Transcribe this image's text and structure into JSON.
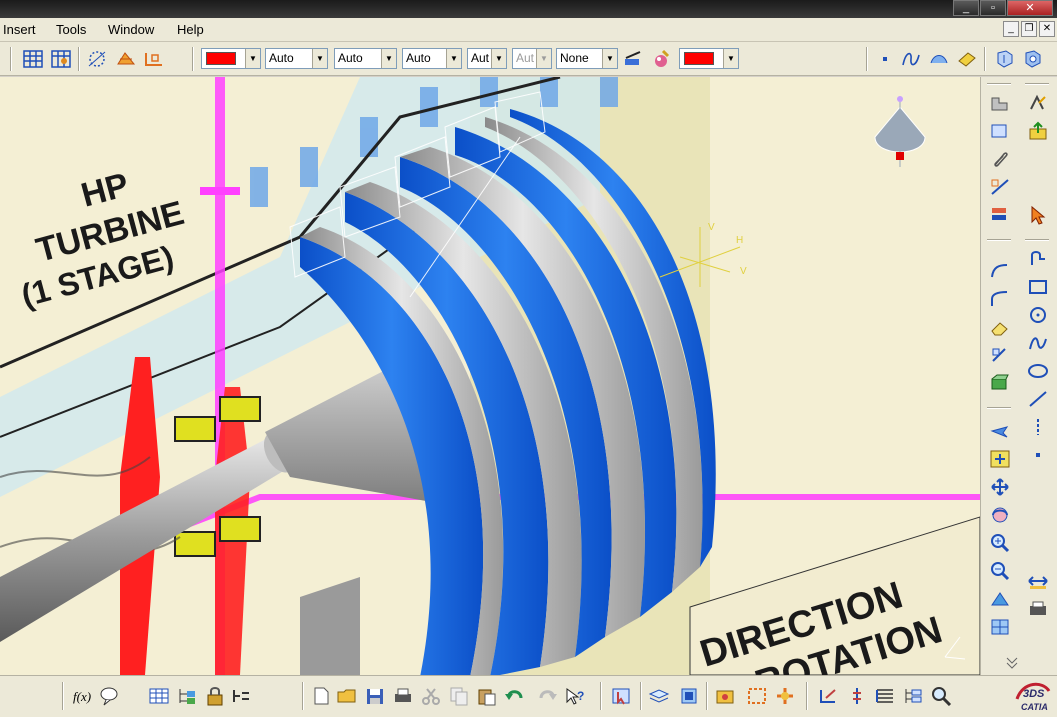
{
  "menu": {
    "items": [
      "Insert",
      "Tools",
      "Window",
      "Help"
    ]
  },
  "toolbar_top": {
    "color_fill": "#ff0000",
    "combos": [
      "Auto",
      "Auto",
      "Auto",
      "Aut",
      "Aut",
      "None"
    ],
    "color_line": "#ff0000"
  },
  "viewport": {
    "drawing_label_1": "HP",
    "drawing_label_2": "TURBINE",
    "drawing_label_3": "(1 STAGE)",
    "drawing_label_4": "DIRECTION",
    "drawing_label_5": "ROTATION",
    "axis_labels": [
      "V",
      "H",
      "V"
    ],
    "accent_blue": "#1565d8",
    "part_gray": "#c8c8c8"
  },
  "branding": {
    "logo_text": "CATIA"
  }
}
